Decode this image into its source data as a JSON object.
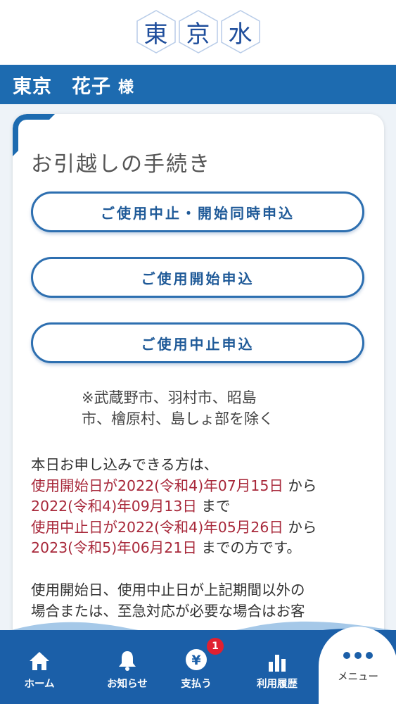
{
  "logo": {
    "chars": [
      "東",
      "京",
      "水"
    ]
  },
  "user": {
    "name": "東京　花子",
    "suffix": "様"
  },
  "card": {
    "title": "お引越しの手続き",
    "buttons": [
      "ご使用中止・開始同時申込",
      "ご使用開始申込",
      "ご使用中止申込"
    ],
    "note_line1": "※武蔵野市、羽村市、昭島",
    "note_line2": "市、檜原村、島しょ部を除く",
    "info": {
      "intro": "本日お申し込みできる方は、",
      "start_red1": "使用開始日が2022(令和4)年07月15日",
      "start_from": " から",
      "start_red2": "2022(令和4)年09月13日",
      "start_until": " まで",
      "stop_red1": "使用中止日が2022(令和4)年05月26日",
      "stop_from": " から",
      "stop_red2": "2023(令和5)年06月21日",
      "stop_until": " までの方です。"
    },
    "info2_line1": "使用開始日、使用中止日が上記期間以外の",
    "info2_line2": "場合または、至急対応が必要な場合はお客"
  },
  "nav": {
    "home": "ホーム",
    "news": "お知らせ",
    "pay": "支払う",
    "pay_badge": "1",
    "usage": "利用履歴",
    "menu": "メニュー"
  },
  "colors": {
    "primary": "#1d6bb0",
    "accent_red": "#a8283a",
    "badge": "#e02030"
  },
  "icons": [
    "home-icon",
    "bell-icon",
    "yen-icon",
    "bar-chart-icon",
    "more-dots-icon"
  ]
}
